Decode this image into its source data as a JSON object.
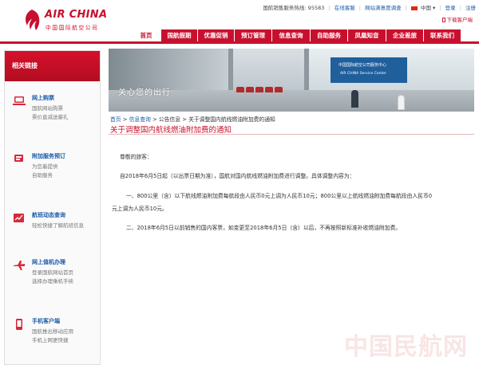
{
  "brand": {
    "logo_text": "AIR CHINA",
    "logo_sub": "中国国际航空公司",
    "accent": "#c8102e"
  },
  "topbar": {
    "hotline_label": "国航销售服务热线: 95583",
    "online_consult": "在线客服",
    "survey": "网站满意度调查",
    "region": "中国",
    "login": "登录",
    "register": "注册",
    "mobile_client": "下载客户端"
  },
  "nav": {
    "items": [
      "首页",
      "国航假期",
      "优惠促销",
      "预订管理",
      "信息查询",
      "自助服务",
      "凤凰知音",
      "企业差旅",
      "联系我们"
    ]
  },
  "sidebar": {
    "heading": "相关链接",
    "items": [
      {
        "title": "网上购票",
        "line1": "国航网站购票",
        "line2": "票价直减送豪礼",
        "icon": "laptop-icon"
      },
      {
        "title": "附加服务预订",
        "line1": "为您着提供",
        "line2": "自助服务",
        "icon": "cart-icon"
      },
      {
        "title": "航班动态查询",
        "line1": "轻松快捷了解航班信息",
        "line2": "",
        "icon": "chart-icon"
      },
      {
        "title": "网上值机办理",
        "line1": "登录国航网站首页",
        "line2": "选择办理乘机手续",
        "icon": "plane-icon"
      },
      {
        "title": "手机客户端",
        "line1": "国航推出移动应用",
        "line2": "手机上网更快捷",
        "icon": "phone-icon"
      }
    ]
  },
  "banner": {
    "tagline": "关心您的出行",
    "sign_cn": "中国国际航空公司服务中心",
    "sign_en": "AIR CHINA Service Center"
  },
  "breadcrumb": {
    "home": "首页",
    "sep": " > ",
    "info": "信息查询",
    "notice": "公告信息",
    "current": "关于调整国内航线燃油附加费的通知"
  },
  "article": {
    "title": "关于调整国内航线燃油附加费的通知",
    "greeting": "尊敬的旅客：",
    "p1": "自2018年6月5日起（以出票日期为准），国航对国内航线燃油附加费进行调整。具体调整内容为：",
    "p2a": "一、800公里（含）以下航线燃油附加费每航段由人民币0元上调为人民币10元；800公里以上航线燃油附加费每航段由人民币0",
    "p2b": "元上调为人民币10元。",
    "p3": "二、2018年6月5日以前销售的国内客票，如变更至2018年6月5日（含）以后，不再按照新标准补收燃油附加费。"
  },
  "watermark": "中国民航网"
}
